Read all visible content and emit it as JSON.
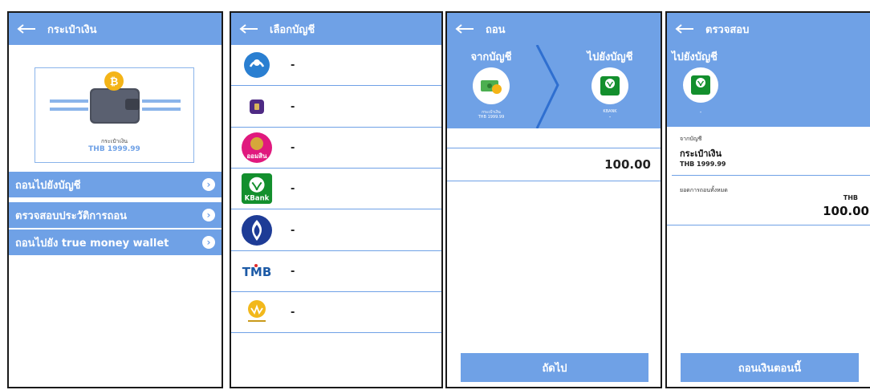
{
  "panel1": {
    "title": "กระเป๋าเงิน",
    "wallet_name": "กระเป๋าเงิน",
    "wallet_balance": "THB 1999.99",
    "menu": [
      {
        "label": "ถอนไปยังบัญชี"
      },
      {
        "label": "ตรวจสอบประวัติการถอน"
      },
      {
        "label": "ถอนไปยัง true money wallet"
      }
    ]
  },
  "panel2": {
    "title": "เลือกบัญชี",
    "banks": [
      {
        "logo": "krungsri-logo",
        "value": "-"
      },
      {
        "logo": "scb-logo",
        "value": "-"
      },
      {
        "logo": "gsb-logo",
        "logo_text": "ออมสิน",
        "value": "-"
      },
      {
        "logo": "kbank-logo",
        "logo_text": "KBank",
        "value": "-"
      },
      {
        "logo": "bangkok-bank-logo",
        "value": "-"
      },
      {
        "logo": "tmb-logo",
        "logo_text": "TMB",
        "value": "-"
      },
      {
        "logo": "krungthai-logo",
        "value": "-"
      }
    ]
  },
  "panel3": {
    "title": "ถอน",
    "from_label": "จากบัญชี",
    "to_label": "ไปยังบัญชี",
    "from_name": "กระเป๋าเงิน",
    "from_balance": "THB 1999.99",
    "to_name": "KBANK",
    "to_value": "-",
    "amount": "100.00",
    "next_button": "ถัดไป"
  },
  "panel4": {
    "title": "ตรวจสอบ",
    "to_label": "ไปยังบัญชี",
    "to_value": "-",
    "from_caption": "จากบัญชี",
    "from_name": "กระเป๋าเงิน",
    "from_balance": "THB 1999.99",
    "total_caption": "ยอดการถอนทั้งหมด",
    "currency": "THB",
    "amount": "100.00",
    "confirm_button": "ถอนเงินตอนนี้"
  },
  "colors": {
    "accent": "#6fa1e6",
    "kbank_green": "#138f2d",
    "gsb_pink": "#e0197e",
    "bbl_blue": "#1e3c96",
    "tmb_blue": "#1c5aa6",
    "tmb_red": "#e12a2a"
  }
}
